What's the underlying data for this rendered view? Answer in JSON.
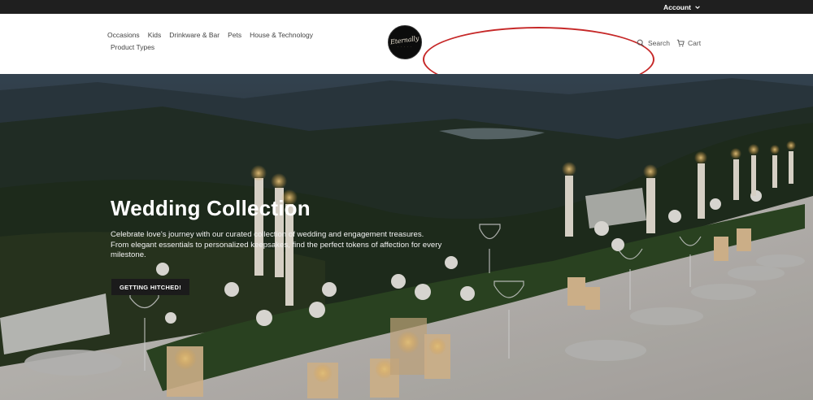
{
  "topbar": {
    "account_label": "Account"
  },
  "nav": {
    "items": [
      "Occasions",
      "Kids",
      "Drinkware & Bar",
      "Pets",
      "House & Technology",
      "Product Types"
    ]
  },
  "logo": {
    "script": "Eternally"
  },
  "header": {
    "search_label": "Search",
    "cart_label": "Cart"
  },
  "hero": {
    "title": "Wedding Collection",
    "description": "Celebrate love's journey with our curated collection of wedding and engagement treasures. From elegant essentials to personalized keepsakes, find the perfect tokens of affection for every milestone.",
    "button_label": "GETTING HITCHED!"
  },
  "colors": {
    "topbar": "#1f1f1f",
    "highlight": "#c62828",
    "button": "#1b1b1b"
  }
}
